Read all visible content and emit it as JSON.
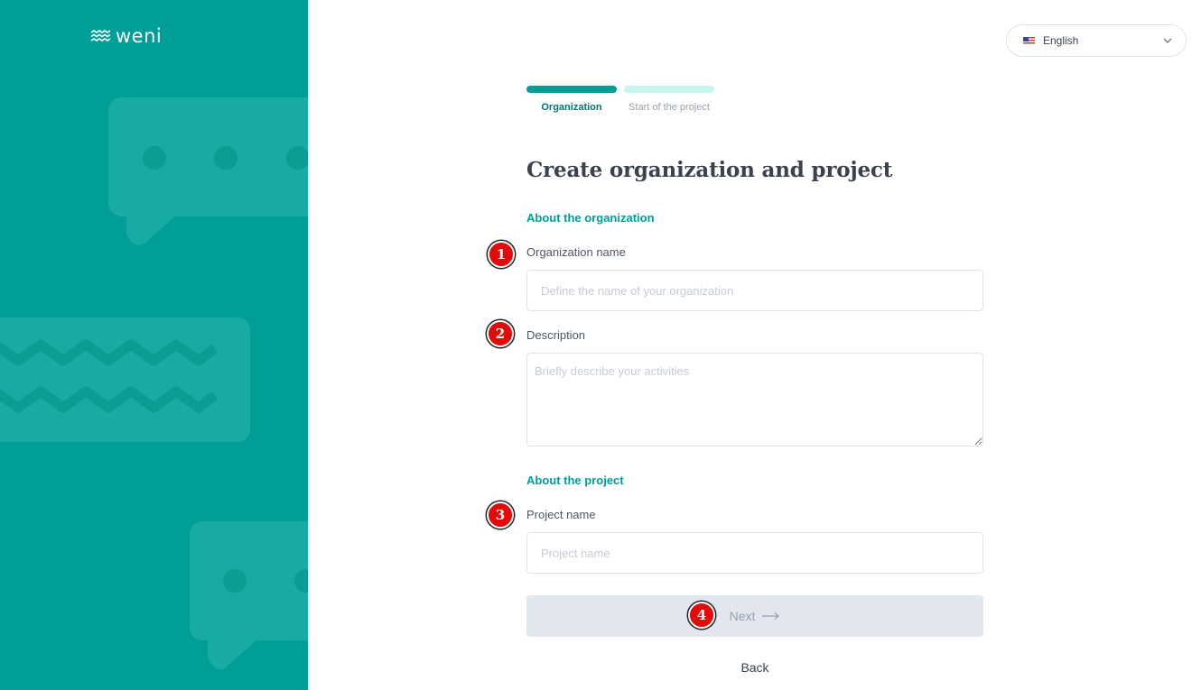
{
  "brand": {
    "logo_text": "weni",
    "icon": "waves-logo-icon",
    "panel_color": "#009e96"
  },
  "language": {
    "flag_icon": "us-flag-icon",
    "label": "English",
    "chevron_icon": "chevron-down-icon"
  },
  "stepper": {
    "steps": [
      {
        "label": "Organization",
        "state": "active"
      },
      {
        "label": "Start of the project",
        "state": "inactive"
      }
    ]
  },
  "form": {
    "title": "Create organization and project",
    "org_section": "About the organization",
    "org_name_label": "Organization name",
    "org_name_placeholder": "Define the name of your organization",
    "description_label": "Description",
    "description_placeholder": "Briefly describe your activities",
    "project_section": "About the project",
    "project_name_label": "Project name",
    "project_name_placeholder": "Project name",
    "next_label": "Next",
    "next_icon": "arrow-right-icon",
    "back_label": "Back"
  },
  "markers": [
    "1",
    "2",
    "3",
    "4"
  ],
  "colors": {
    "accent": "#009e96",
    "accent_light": "#c8f4f0",
    "marker": "#e40a0a",
    "disabled_button": "#e2e6ee"
  }
}
